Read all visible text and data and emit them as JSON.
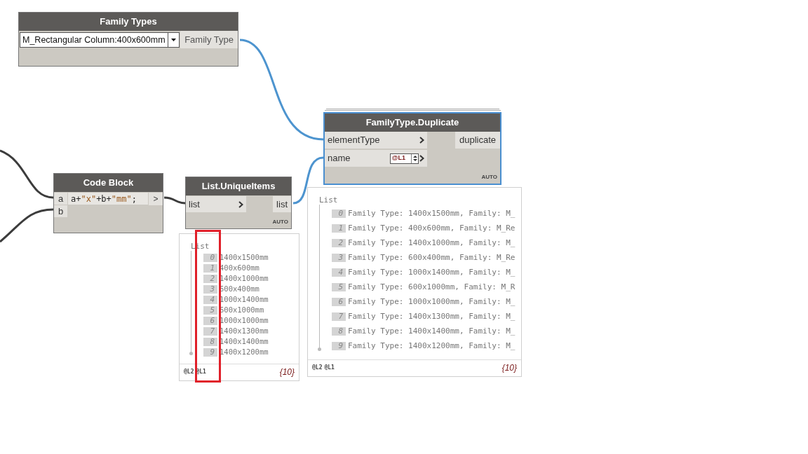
{
  "family_types_node": {
    "title": "Family Types",
    "dropdown_value": "M_Rectangular Column:400x600mm",
    "output": "Family Type"
  },
  "code_block_node": {
    "title": "Code Block",
    "inputs": [
      "a",
      "b"
    ],
    "code": "a+\"x\"+b+\"mm\";",
    "output": ">"
  },
  "unique_items_node": {
    "title": "List.UniqueItems",
    "input": "list",
    "output": "list",
    "lacing": "AUTO"
  },
  "unique_items_preview": {
    "header": "List",
    "items": [
      {
        "index": "0",
        "value": "1400x1500mm"
      },
      {
        "index": "1",
        "value": "400x600mm"
      },
      {
        "index": "2",
        "value": "1400x1000mm"
      },
      {
        "index": "3",
        "value": "600x400mm"
      },
      {
        "index": "4",
        "value": "1000x1400mm"
      },
      {
        "index": "5",
        "value": "600x1000mm"
      },
      {
        "index": "6",
        "value": "1000x1000mm"
      },
      {
        "index": "7",
        "value": "1400x1300mm"
      },
      {
        "index": "8",
        "value": "1400x1400mm"
      },
      {
        "index": "9",
        "value": "1400x1200mm"
      }
    ],
    "levels": [
      "@L2",
      "@L1"
    ],
    "count": "{10}"
  },
  "duplicate_node": {
    "title": "FamilyType.Duplicate",
    "selected": true,
    "inputs": [
      {
        "name": "elementType"
      },
      {
        "name": "name",
        "level_tag": "@L1"
      }
    ],
    "output": "duplicate",
    "lacing": "AUTO"
  },
  "duplicate_preview": {
    "header": "List",
    "items": [
      {
        "index": "0",
        "value": "Family Type: 1400x1500mm, Family: M_"
      },
      {
        "index": "1",
        "value": "Family Type: 400x600mm, Family: M_Re"
      },
      {
        "index": "2",
        "value": "Family Type: 1400x1000mm, Family: M_"
      },
      {
        "index": "3",
        "value": "Family Type: 600x400mm, Family: M_Re"
      },
      {
        "index": "4",
        "value": "Family Type: 1000x1400mm, Family: M_"
      },
      {
        "index": "5",
        "value": "Family Type: 600x1000mm, Family: M_R"
      },
      {
        "index": "6",
        "value": "Family Type: 1000x1000mm, Family: M_"
      },
      {
        "index": "7",
        "value": "Family Type: 1400x1300mm, Family: M_"
      },
      {
        "index": "8",
        "value": "Family Type: 1400x1400mm, Family: M_"
      },
      {
        "index": "9",
        "value": "Family Type: 1400x1200mm, Family: M_"
      }
    ],
    "levels": [
      "@L2",
      "@L1"
    ],
    "count": "{10}"
  }
}
